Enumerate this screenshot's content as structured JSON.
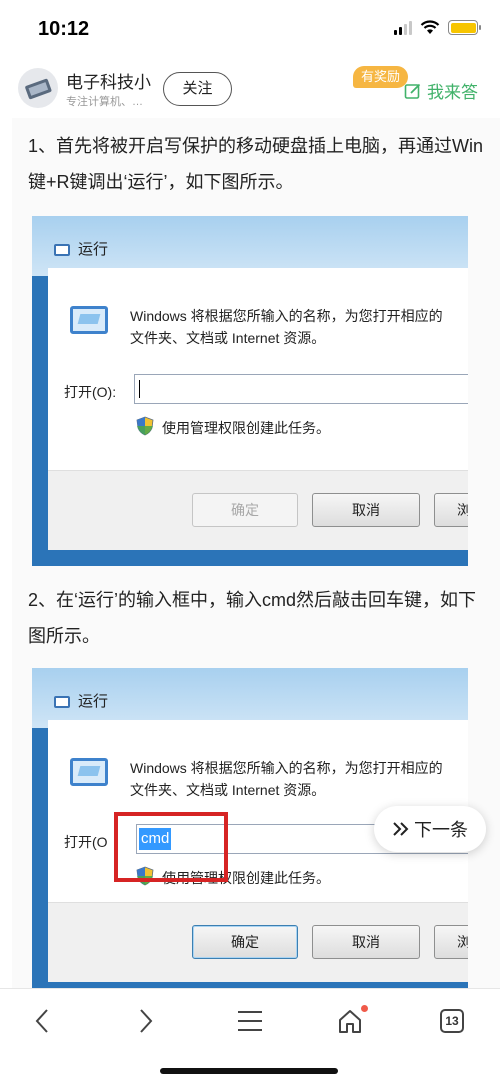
{
  "status_bar": {
    "time": "10:12"
  },
  "author": {
    "name": "电子科技小",
    "description": "专注计算机、…",
    "follow_label": "关注"
  },
  "header_actions": {
    "reward_badge": "有奖励",
    "answer_label": "我来答"
  },
  "article": {
    "step1_text": "1、首先将被开启写保护的移动硬盘插上电脑，再通过Win键+R键调出‘运行’，如下图所示。",
    "step2_text": "2、在‘运行’的输入框中，输入cmd然后敲击回车键，如下图所示。",
    "run_dialog": {
      "title": "运行",
      "description_line1": "Windows 将根据您所输入的名称，为您打开相应的",
      "description_line2": "文件夹、文档或 Internet 资源。",
      "open_label": "打开(O):",
      "admin_note": "使用管理权限创建此任务。",
      "ok_label": "确定",
      "cancel_label": "取消",
      "browse_label": "浏"
    },
    "run_dialog_2": {
      "open_label": "打开(O",
      "input_value": "cmd",
      "admin_note": "使用管理权限创建此任务。"
    }
  },
  "next_item": {
    "label": "下一条"
  },
  "bottom_nav": {
    "tab_count": "13"
  },
  "colors": {
    "accent_green": "#41b26a",
    "reward_orange": "#f6b642",
    "highlight_red": "#d62424",
    "selection_blue": "#3399ff"
  },
  "icons": [
    "wifi-icon",
    "battery-icon",
    "edit-answer-icon",
    "shield-icon",
    "back-icon",
    "forward-icon",
    "menu-icon",
    "home-icon",
    "tabs-icon",
    "next-arrow-icon"
  ]
}
